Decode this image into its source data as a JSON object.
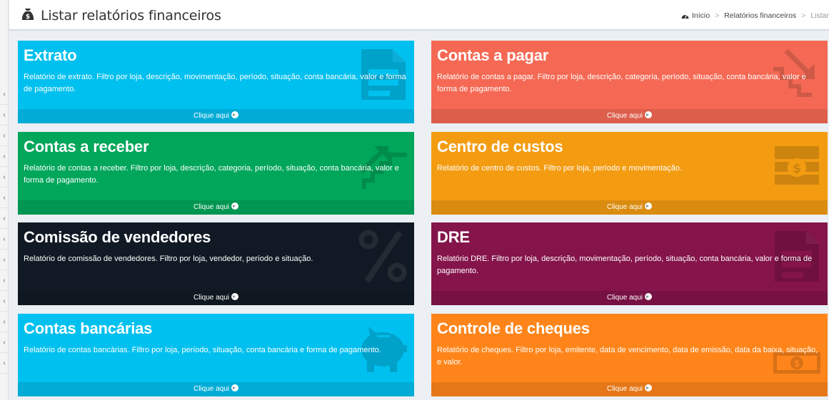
{
  "header": {
    "title": "Listar relatórios financeiros",
    "title_icon": "money-bag-icon",
    "breadcrumb": {
      "home": "Início",
      "section": "Relatórios financeiros",
      "current": "Listar"
    }
  },
  "sidebar": {
    "collapse_icon": "chevron-left-icon",
    "chevron": "‹"
  },
  "colors": {
    "aqua": "#00c0ef",
    "red": "#f56954",
    "green": "#00a65a",
    "yellow": "#f39c12",
    "navy": "#111a24",
    "maroon": "#85144b",
    "orange": "#ff851b"
  },
  "reports": [
    {
      "title": "Extrato",
      "description": "Relatório de extrato. Filtro por loja, descrição, movimentação, período, situação, conta bancária, valor e forma de pagamento.",
      "link": "Clique aqui",
      "icon": "document-icon",
      "color": "aqua"
    },
    {
      "title": "Contas a pagar",
      "description": "Relatório de contas a pagar. Filtro por loja, descrição, categoria, período, situação, conta bancária, valor e forma de pagamento.",
      "link": "Clique aqui",
      "icon": "trend-down-icon",
      "color": "red"
    },
    {
      "title": "Contas a receber",
      "description": "Relatório de contas a receber. Filtro por loja, descrição, categoria, período, situação, conta bancária, valor e forma de pagamento.",
      "link": "Clique aqui",
      "icon": "trend-up-icon",
      "color": "green"
    },
    {
      "title": "Centro de custos",
      "description": "Relatório de centro de custos. Filtro por loja, período e movimentação.",
      "link": "Clique aqui",
      "icon": "money-stack-icon",
      "color": "yellow"
    },
    {
      "title": "Comissão de vendedores",
      "description": "Relatório de comissão de vendedores. Filtro por loja, vendedor, período e situação.",
      "link": "Clique aqui",
      "icon": "percent-icon",
      "color": "navy"
    },
    {
      "title": "DRE",
      "description": "Relatório DRE. Filtro por loja, descrição, movimentação, período, situação, conta bancária, valor e forma de pagamento.",
      "link": "Clique aqui",
      "icon": "document-icon",
      "color": "maroon"
    },
    {
      "title": "Contas bancárias",
      "description": "Relatório de contas bancárias. Filtro por loja, período, situação, conta bancária e forma de pagamento.",
      "link": "Clique aqui",
      "icon": "piggy-bank-icon",
      "color": "aqua"
    },
    {
      "title": "Controle de cheques",
      "description": "Relatório de cheques. Filtro por loja, emitente, data de vencimento, data de emissão, data da baixa, situação, e valor.",
      "link": "Clique aqui",
      "icon": "banknote-icon",
      "color": "orange"
    }
  ]
}
